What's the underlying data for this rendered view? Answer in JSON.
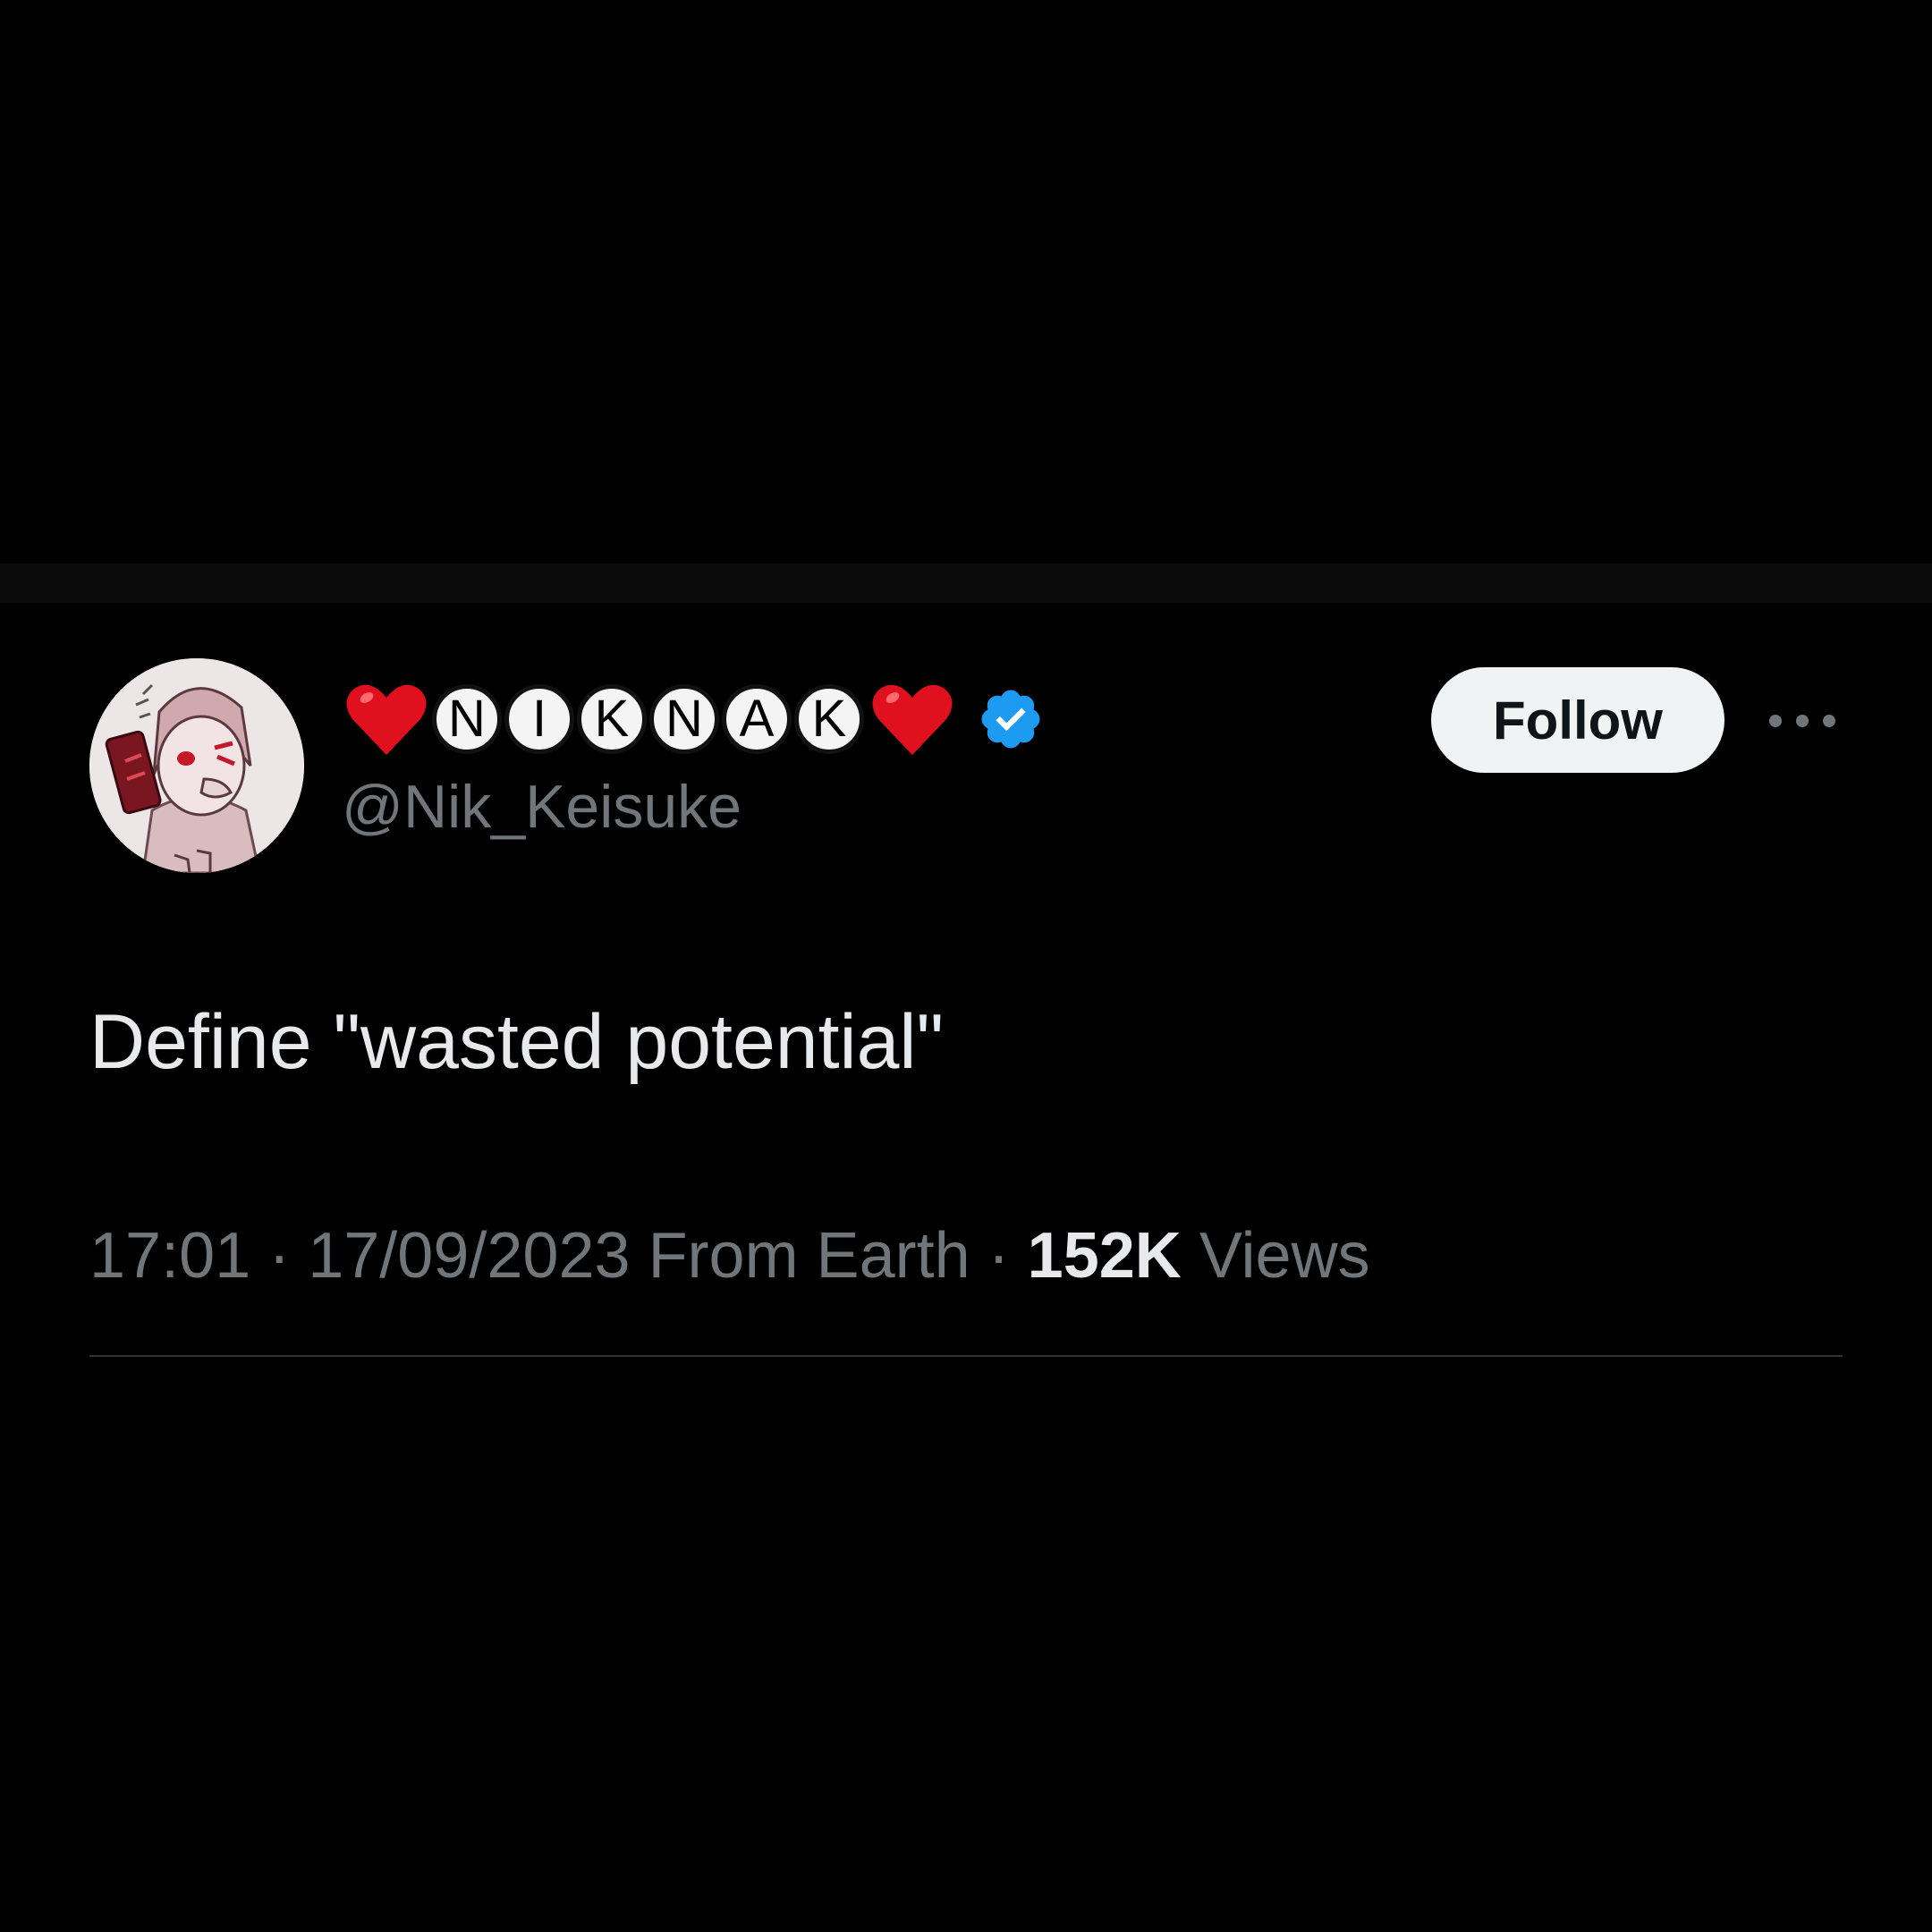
{
  "tweet": {
    "display_name_letters": [
      "N",
      "I",
      "K",
      "N",
      "A",
      "K"
    ],
    "verified": true,
    "handle": "@Nik_Keisuke",
    "follow_label": "Follow",
    "text": "Define \"wasted potential\"",
    "time": "17:01",
    "separator": "·",
    "date": "17/09/2023",
    "source": "From Earth",
    "views_count": "152K",
    "views_label": "Views"
  },
  "icons": {
    "heart": "heart-icon",
    "verified": "verified-badge-icon",
    "more": "more-options-icon"
  },
  "colors": {
    "background": "#000000",
    "primary_text": "#e7e9ea",
    "secondary_text": "#71767b",
    "verified_blue": "#1d9bf0",
    "heart_red": "#e0101e",
    "follow_bg": "#eff3f4"
  }
}
